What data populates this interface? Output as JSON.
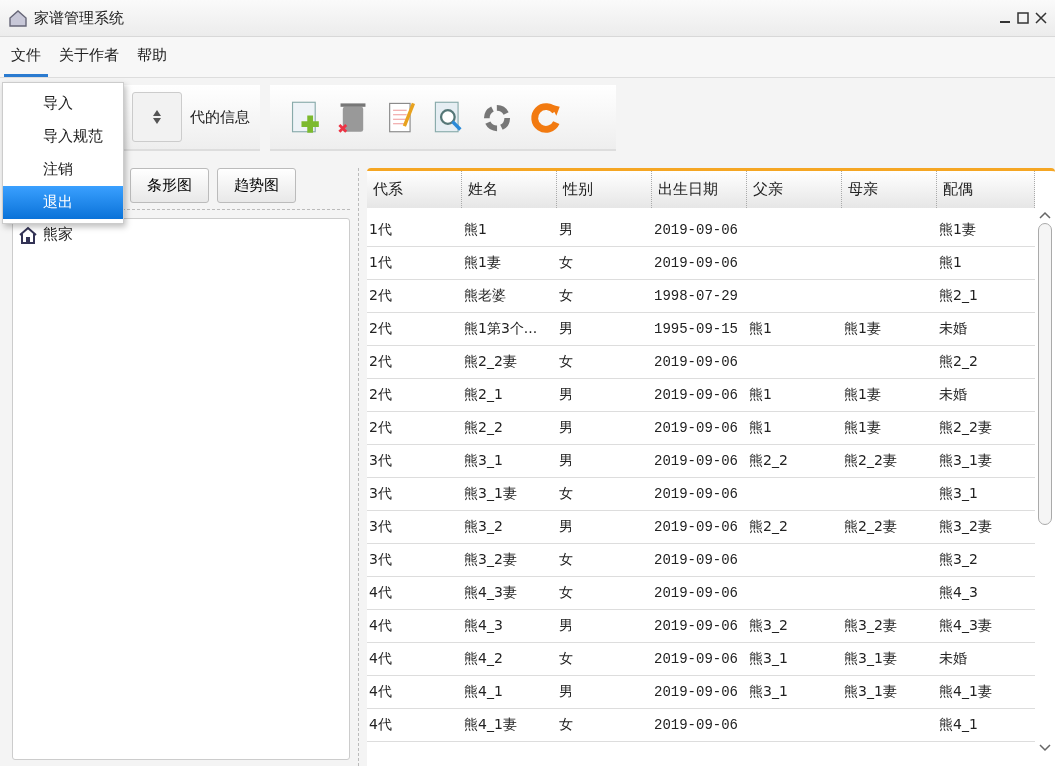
{
  "window": {
    "title": "家谱管理系统"
  },
  "menu": [
    {
      "label": "文件",
      "selected": true
    },
    {
      "label": "关于作者",
      "selected": false
    },
    {
      "label": "帮助",
      "selected": false
    }
  ],
  "file_menu": [
    {
      "label": "导入",
      "selected": false
    },
    {
      "label": "导入规范",
      "selected": false
    },
    {
      "label": "注销",
      "selected": false
    },
    {
      "label": "退出",
      "selected": true
    }
  ],
  "filter": {
    "suffix": "代的信息"
  },
  "chart_buttons": [
    "条形图",
    "趋势图"
  ],
  "tree": [
    {
      "label": "熊家"
    }
  ],
  "table": {
    "columns": [
      "代系",
      "姓名",
      "性别",
      "出生日期",
      "父亲",
      "母亲",
      "配偶"
    ],
    "rows": [
      [
        "1代",
        "熊1",
        "男",
        "2019-09-06",
        "",
        "",
        "熊1妻"
      ],
      [
        "1代",
        "熊1妻",
        "女",
        "2019-09-06",
        "",
        "",
        "熊1"
      ],
      [
        "2代",
        "熊老婆",
        "女",
        "1998-07-29",
        "",
        "",
        "熊2_1"
      ],
      [
        "2代",
        "熊1第3个...",
        "男",
        "1995-09-15",
        "熊1",
        "熊1妻",
        "未婚"
      ],
      [
        "2代",
        "熊2_2妻",
        "女",
        "2019-09-06",
        "",
        "",
        "熊2_2"
      ],
      [
        "2代",
        "熊2_1",
        "男",
        "2019-09-06",
        "熊1",
        "熊1妻",
        "未婚"
      ],
      [
        "2代",
        "熊2_2",
        "男",
        "2019-09-06",
        "熊1",
        "熊1妻",
        "熊2_2妻"
      ],
      [
        "3代",
        "熊3_1",
        "男",
        "2019-09-06",
        "熊2_2",
        "熊2_2妻",
        "熊3_1妻"
      ],
      [
        "3代",
        "熊3_1妻",
        "女",
        "2019-09-06",
        "",
        "",
        "熊3_1"
      ],
      [
        "3代",
        "熊3_2",
        "男",
        "2019-09-06",
        "熊2_2",
        "熊2_2妻",
        "熊3_2妻"
      ],
      [
        "3代",
        "熊3_2妻",
        "女",
        "2019-09-06",
        "",
        "",
        "熊3_2"
      ],
      [
        "4代",
        "熊4_3妻",
        "女",
        "2019-09-06",
        "",
        "",
        "熊4_3"
      ],
      [
        "4代",
        "熊4_3",
        "男",
        "2019-09-06",
        "熊3_2",
        "熊3_2妻",
        "熊4_3妻"
      ],
      [
        "4代",
        "熊4_2",
        "女",
        "2019-09-06",
        "熊3_1",
        "熊3_1妻",
        "未婚"
      ],
      [
        "4代",
        "熊4_1",
        "男",
        "2019-09-06",
        "熊3_1",
        "熊3_1妻",
        "熊4_1妻"
      ],
      [
        "4代",
        "熊4_1妻",
        "女",
        "2019-09-06",
        "",
        "",
        "熊4_1"
      ]
    ]
  }
}
